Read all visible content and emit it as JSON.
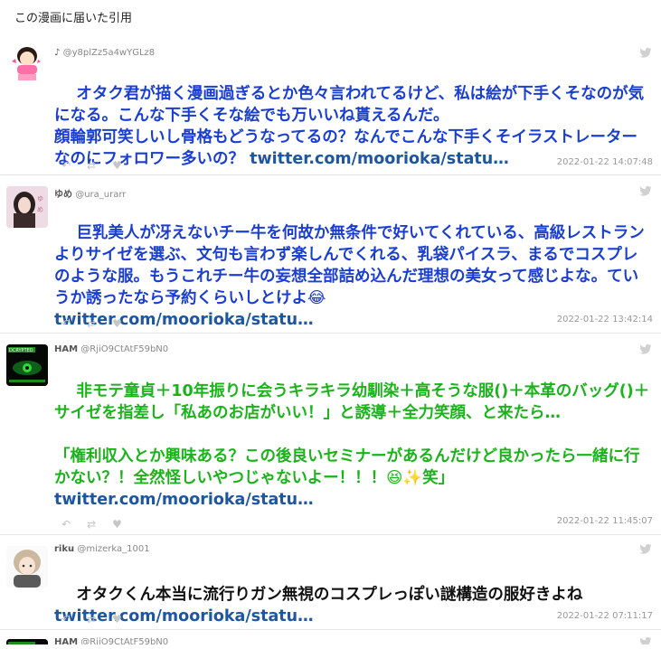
{
  "page": {
    "title": "この漫画に届いた引用"
  },
  "tweets": [
    {
      "name": "♪",
      "handle": "@y8plZz5a4wYGLz8",
      "text": "オタク君が描く漫画過ぎるとか色々言われてるけど、私は絵が下手くそなのが気になる。こんな下手くそな絵でも万いいね貰えるんだ。\n顔輪郭可笑しいし骨格もどうなってるの？なんでこんな下手くそイラストレーターなのにフォロワー多いの？ ",
      "link": "twitter.com/moorioka/statu…",
      "text_color": "#1a3ed1",
      "timestamp": "2022-01-22 14:07:48"
    },
    {
      "name": "ゆめ",
      "handle": "@ura_urarr",
      "text": "巨乳美人が冴えないチー牛を何故か無条件で好いてくれている、高級レストランよりサイゼを選ぶ、文句も言わず楽しんでくれる、乳袋パイスラ、まるでコスプレのような服。もうこれチー牛の妄想全部詰め込んだ理想の美女って感じよな。ていうか誘ったなら予約くらいしとけよ😂\n",
      "link": "twitter.com/moorioka/statu…",
      "text_color": "#1a3ed1",
      "timestamp": "2022-01-22 13:42:14"
    },
    {
      "name": "HAM",
      "handle": "@RjiO9CtAtF59bN0",
      "text": "非モテ童貞＋10年振りに会うキラキラ幼馴染＋高そうな服()＋本革のバッグ()＋サイゼを指差し「私あのお店がいい！」と誘導＋全力笑顔、と来たら…\n\n「権利収入とか興味ある？この後良いセミナーがあるんだけど良かったら一緒に行かない？！全然怪しいやつじゃないよー！！！😆✨笑」\n",
      "link": "twitter.com/moorioka/statu…",
      "text_color": "#1ab31a",
      "timestamp": "2022-01-22 11:45:07"
    },
    {
      "name": "riku",
      "handle": "@mizerka_1001",
      "text": "オタクくん本当に流行りガン無視のコスプレっぽい謎構造の服好きよね\n",
      "link": "twitter.com/moorioka/statu…",
      "text_color": "#111111",
      "timestamp": "2022-01-22 07:11:17"
    },
    {
      "name": "HAM",
      "handle": "@RjiO9CtAtF59bN0"
    }
  ],
  "icons": {
    "reply": "reply-icon",
    "retweet": "retweet-icon",
    "like": "heart-icon",
    "bird": "twitter-bird-icon"
  }
}
